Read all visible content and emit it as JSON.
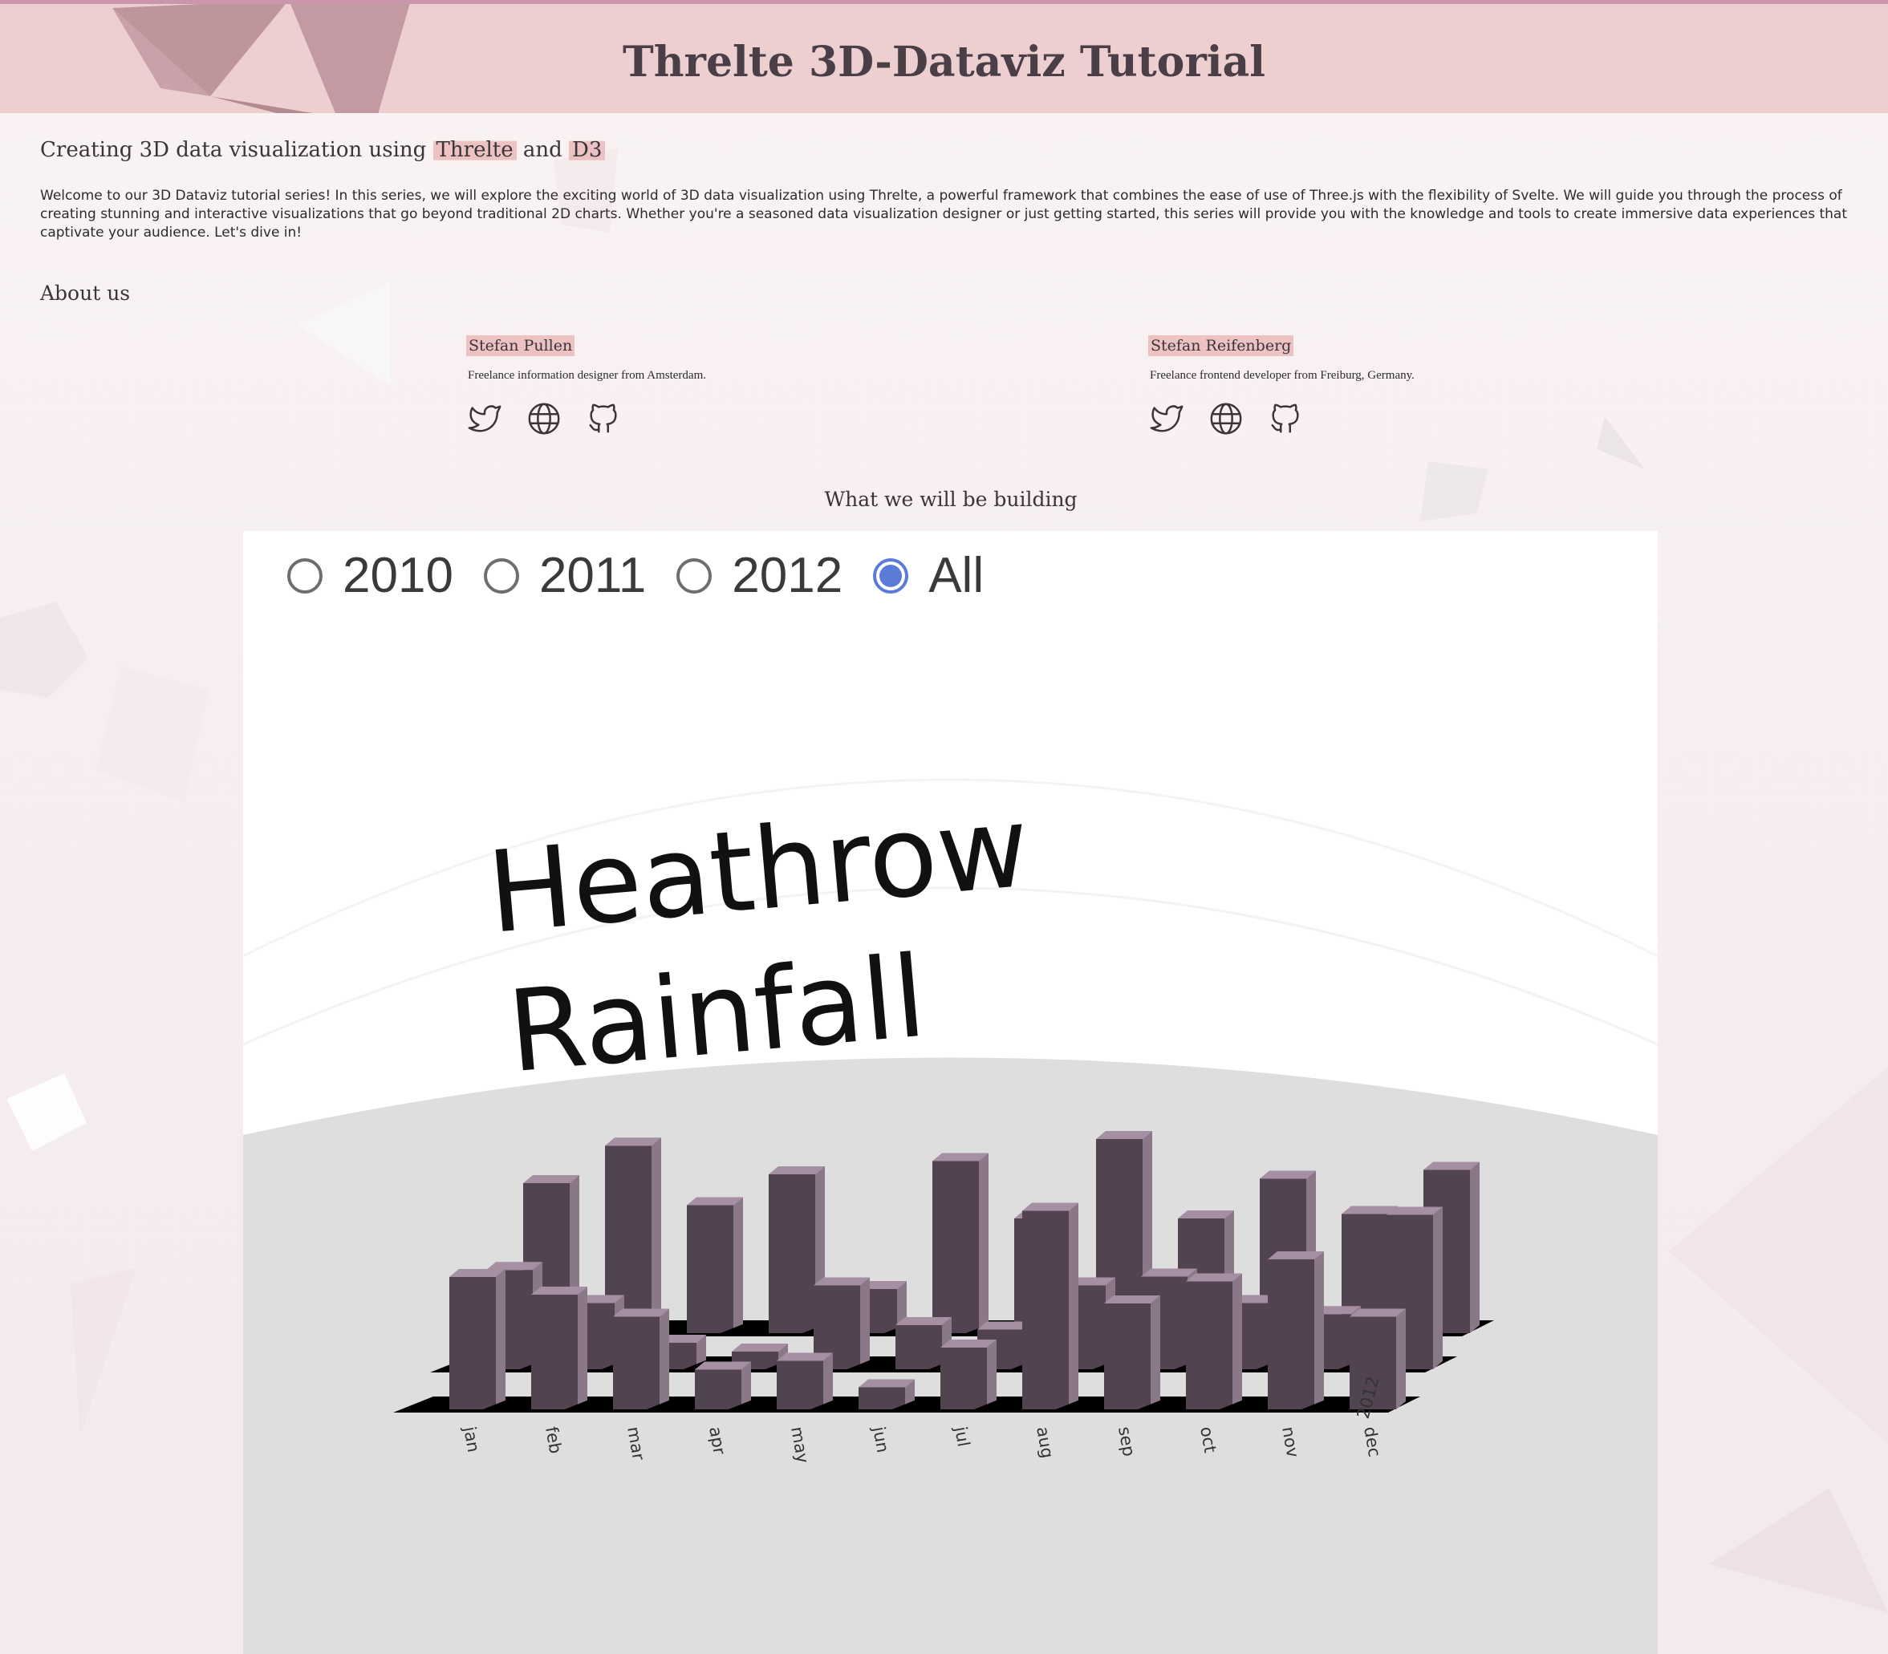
{
  "header": {
    "title": "Threlte 3D-Dataviz Tutorial"
  },
  "intro": {
    "heading_prefix": "Creating 3D data visualization using ",
    "heading_threlte": "Threlte",
    "heading_and": " and ",
    "heading_d3": "D3",
    "text": "Welcome to our 3D Dataviz tutorial series! In this series, we will explore the exciting world of 3D data visualization using Threlte, a powerful framework that combines the ease of use of Three.js with the flexibility of Svelte. We will guide you through the process of creating stunning and interactive visualizations that go beyond traditional 2D charts. Whether you're a seasoned data visualization designer or just getting started, this series will provide you with the knowledge and tools to create immersive data experiences that captivate your audience. Let's dive in!"
  },
  "about": {
    "heading": "About us",
    "authors": [
      {
        "name": "Stefan Pullen",
        "bio": "Freelance information designer from Amsterdam.",
        "icons": [
          "twitter-icon",
          "globe-icon",
          "github-icon"
        ]
      },
      {
        "name": "Stefan Reifenberg",
        "bio": "Freelance frontend developer from Freiburg, Germany.",
        "icons": [
          "twitter-icon",
          "globe-icon",
          "github-icon"
        ]
      }
    ]
  },
  "demo": {
    "heading": "What we will be building",
    "year_options": [
      {
        "label": "2010",
        "checked": false
      },
      {
        "label": "2011",
        "checked": false
      },
      {
        "label": "2012",
        "checked": false
      },
      {
        "label": "All",
        "checked": true
      }
    ]
  },
  "colors": {
    "header_bg": "#eecfcf",
    "highlight": "#e8b2b2",
    "bar_face": "#524350",
    "bar_top": "#a48fa3",
    "radio_accent": "#5b7bd8",
    "floor": "#dedede"
  },
  "chart_data": {
    "type": "bar",
    "title_lines": [
      "Heathrow",
      "Rainfall"
    ],
    "categories": [
      "jan",
      "feb",
      "mar",
      "apr",
      "may",
      "jun",
      "jul",
      "aug",
      "sep",
      "oct",
      "nov",
      "dec"
    ],
    "z_labels": [
      "2012"
    ],
    "series": [
      {
        "name": "2010",
        "values": [
          60,
          52,
          42,
          18,
          22,
          10,
          28,
          90,
          48,
          58,
          68,
          42
        ]
      },
      {
        "name": "2011",
        "values": [
          45,
          30,
          12,
          8,
          38,
          20,
          18,
          38,
          42,
          30,
          25,
          70
        ]
      },
      {
        "name": "2012",
        "values": [
          68,
          85,
          58,
          72,
          20,
          78,
          52,
          88,
          52,
          70,
          54,
          74
        ]
      }
    ]
  }
}
